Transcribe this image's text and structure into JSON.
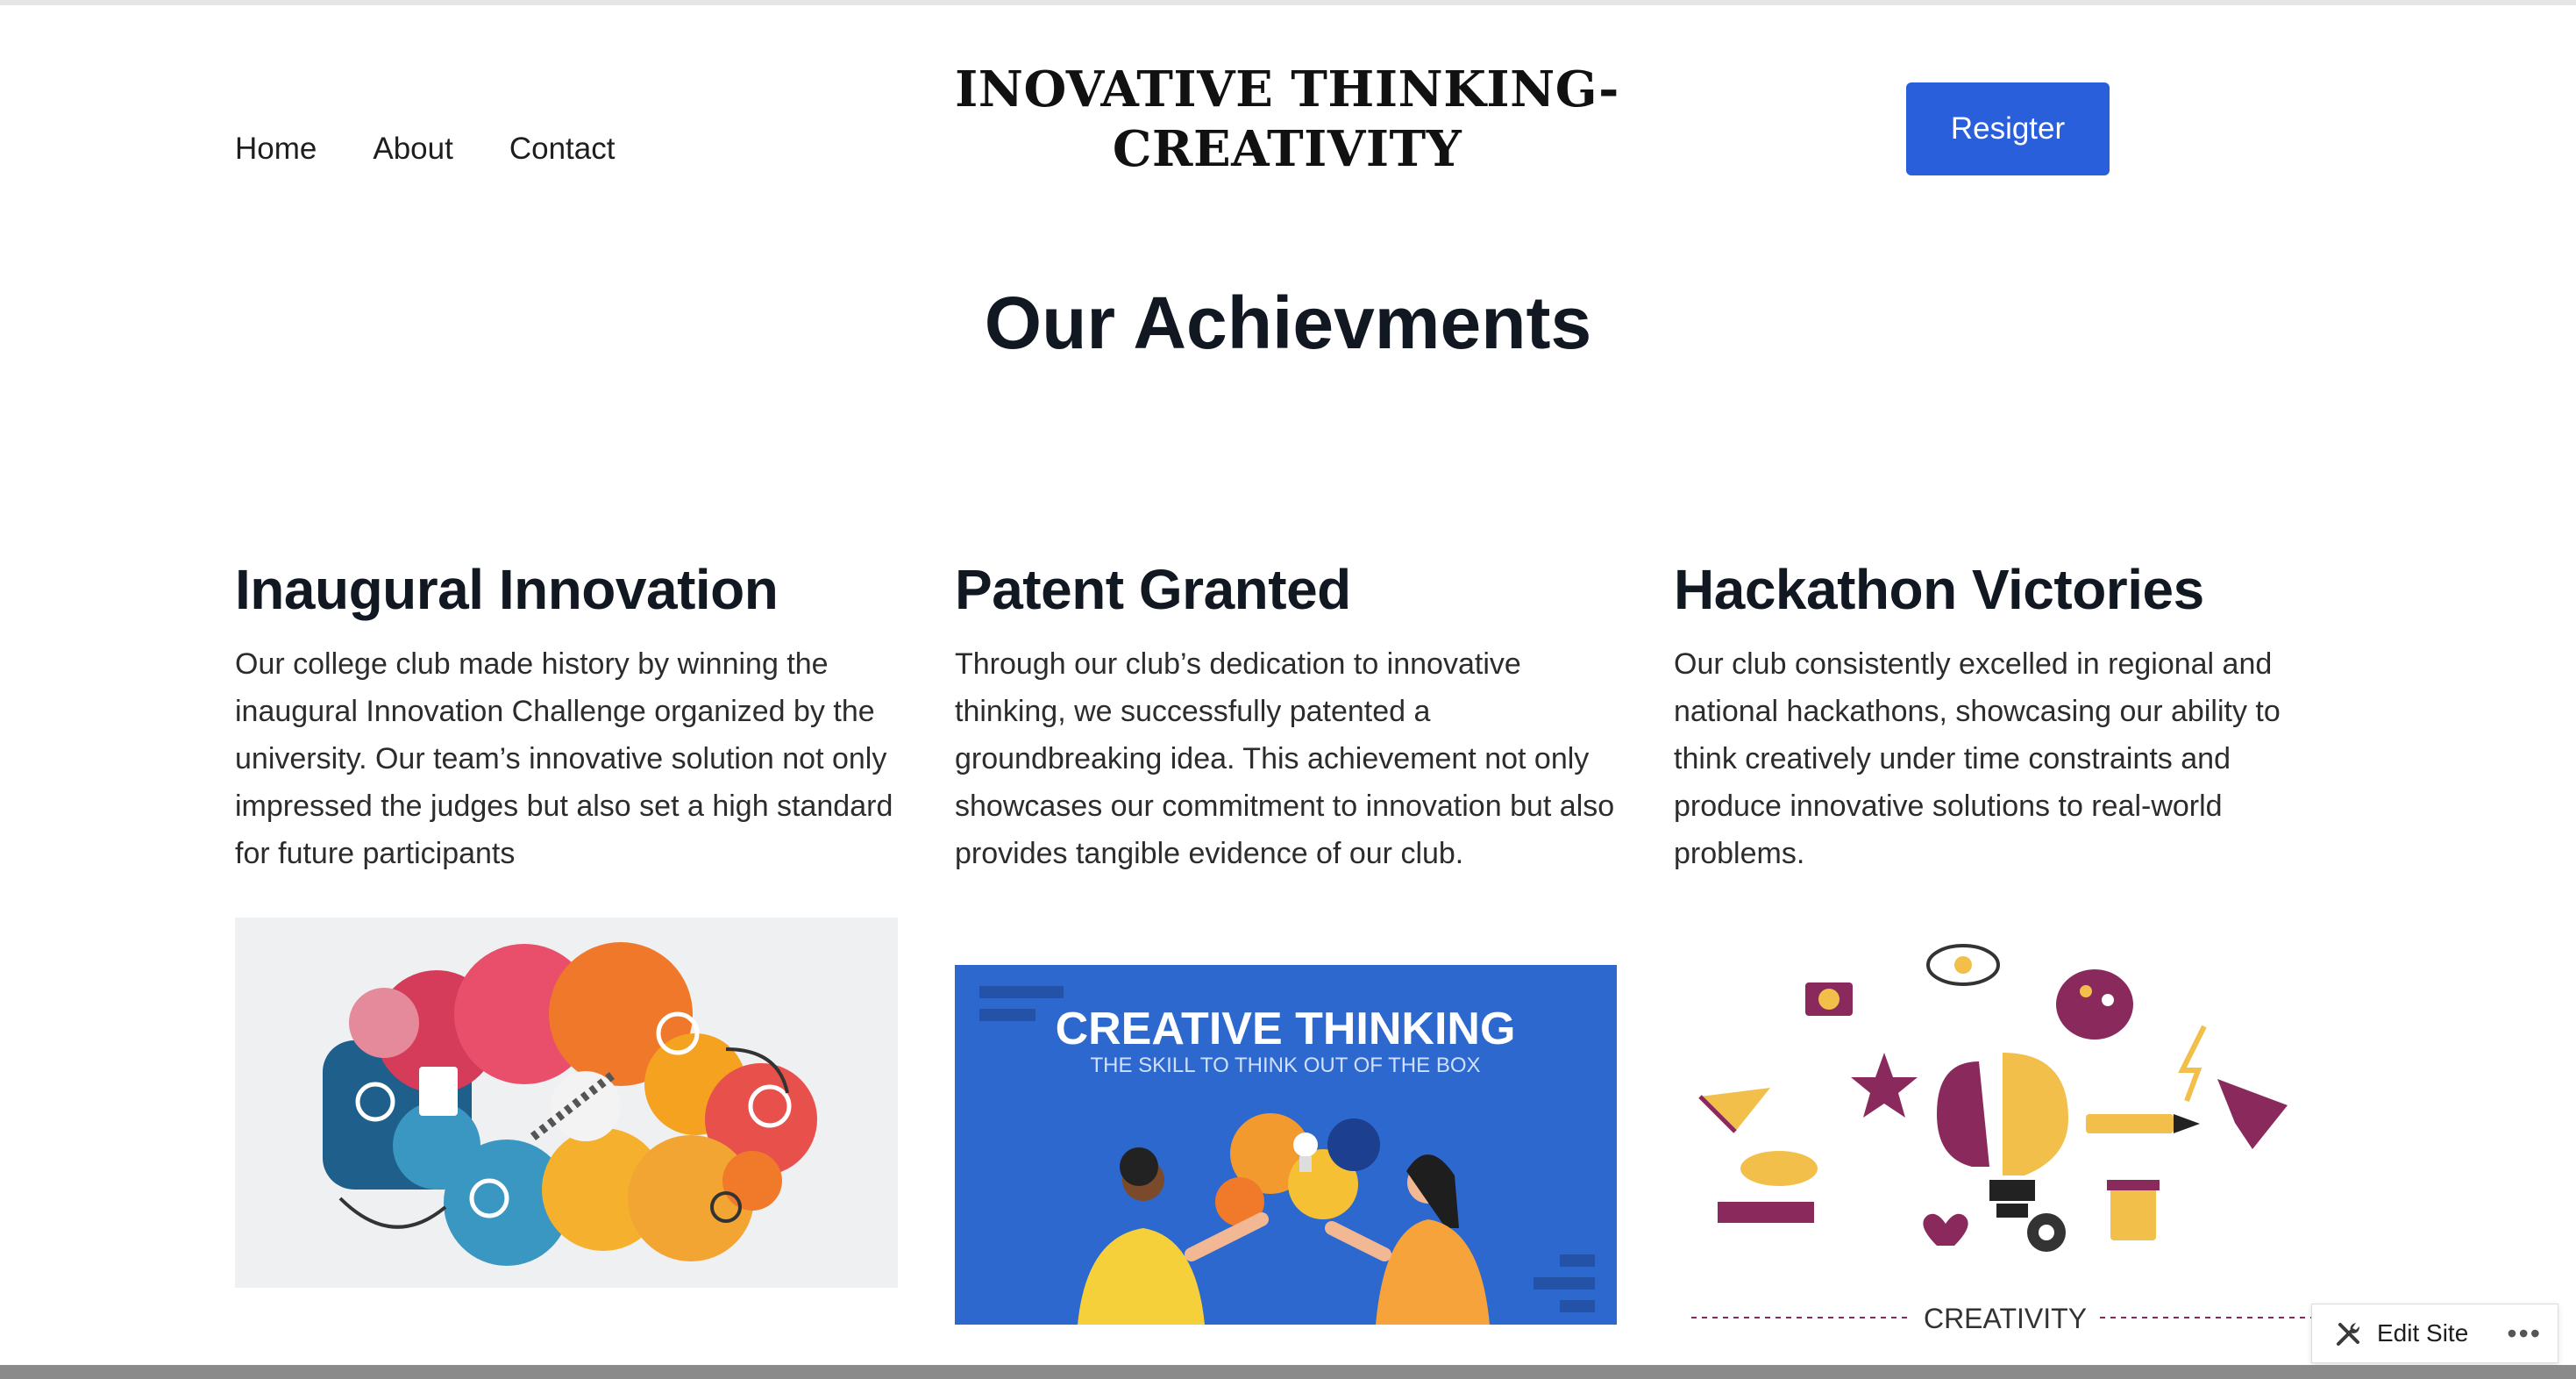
{
  "header": {
    "nav": [
      "Home",
      "About",
      "Contact"
    ],
    "site_title_line1": "INOVATIVE THINKING-",
    "site_title_line2": "CREATIVITY",
    "register_label": "Resigter"
  },
  "main": {
    "title": "Our Achievments",
    "cards": [
      {
        "heading": "Inaugural Innovation",
        "text": "Our college club made history by winning the inaugural Innovation Challenge organized by the university. Our team’s innovative solution not only impressed the judges but also set a high standard for future participants"
      },
      {
        "heading": "Patent Granted",
        "text": "Through our club’s dedication to innovative thinking, we successfully patented a groundbreaking idea. This achievement not only showcases our commitment to innovation but also provides tangible evidence of our club.",
        "image_title": "CREATIVE THINKING",
        "image_subtitle": "THE SKILL TO THINK OUT OF THE BOX"
      },
      {
        "heading": "Hackathon Victories",
        "text": "Our club consistently excelled in regional and national hackathons, showcasing our ability to think creatively under time constraints and produce innovative solutions to real-world problems.",
        "image_caption": "CREATIVITY"
      }
    ]
  },
  "admin_bar": {
    "edit_label": "Edit Site",
    "more_label": "•••"
  },
  "colors": {
    "accent": "#2a5fdc",
    "image2_bg": "#2d68cf"
  }
}
